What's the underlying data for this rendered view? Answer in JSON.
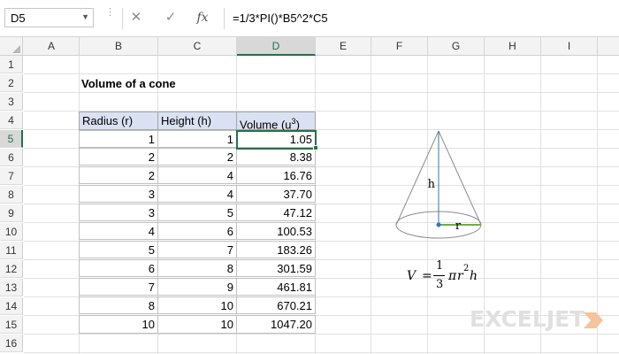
{
  "formula_bar": {
    "name_box": "D5",
    "cancel_icon": "✕",
    "enter_icon": "✓",
    "fx_label": "fx",
    "formula": "=1/3*PI()*B5^2*C5"
  },
  "columns": [
    "A",
    "B",
    "C",
    "D",
    "E",
    "F",
    "G",
    "H",
    "I"
  ],
  "rows": [
    "1",
    "2",
    "3",
    "4",
    "5",
    "6",
    "7",
    "8",
    "9",
    "10",
    "11",
    "12",
    "13",
    "14",
    "15",
    "16"
  ],
  "sheet": {
    "title": "Volume of a cone",
    "headers": {
      "radius": "Radius (r)",
      "height": "Height (h)",
      "volume_prefix": "Volume (u",
      "volume_sup": "3",
      "volume_suffix": ")"
    },
    "table": [
      [
        "1",
        "1",
        "1.05"
      ],
      [
        "2",
        "2",
        "8.38"
      ],
      [
        "2",
        "4",
        "16.76"
      ],
      [
        "3",
        "4",
        "37.70"
      ],
      [
        "3",
        "5",
        "47.12"
      ],
      [
        "4",
        "6",
        "100.53"
      ],
      [
        "5",
        "7",
        "183.26"
      ],
      [
        "6",
        "8",
        "301.59"
      ],
      [
        "7",
        "9",
        "461.81"
      ],
      [
        "8",
        "10",
        "670.21"
      ],
      [
        "10",
        "10",
        "1047.20"
      ]
    ]
  },
  "diagram": {
    "height_label": "h",
    "radius_label": "r"
  },
  "cone_formula": {
    "lhs": "V",
    "equals": "=",
    "num": "1",
    "den": "3",
    "pi": "π",
    "r": "r",
    "exp": "2",
    "h": "h"
  },
  "logo": {
    "text": "EXCELJET"
  },
  "colors": {
    "accent": "#217346",
    "header_fill": "#d9e1f2",
    "axis_line": "#2e75b6",
    "radius_line": "#70ad47"
  }
}
